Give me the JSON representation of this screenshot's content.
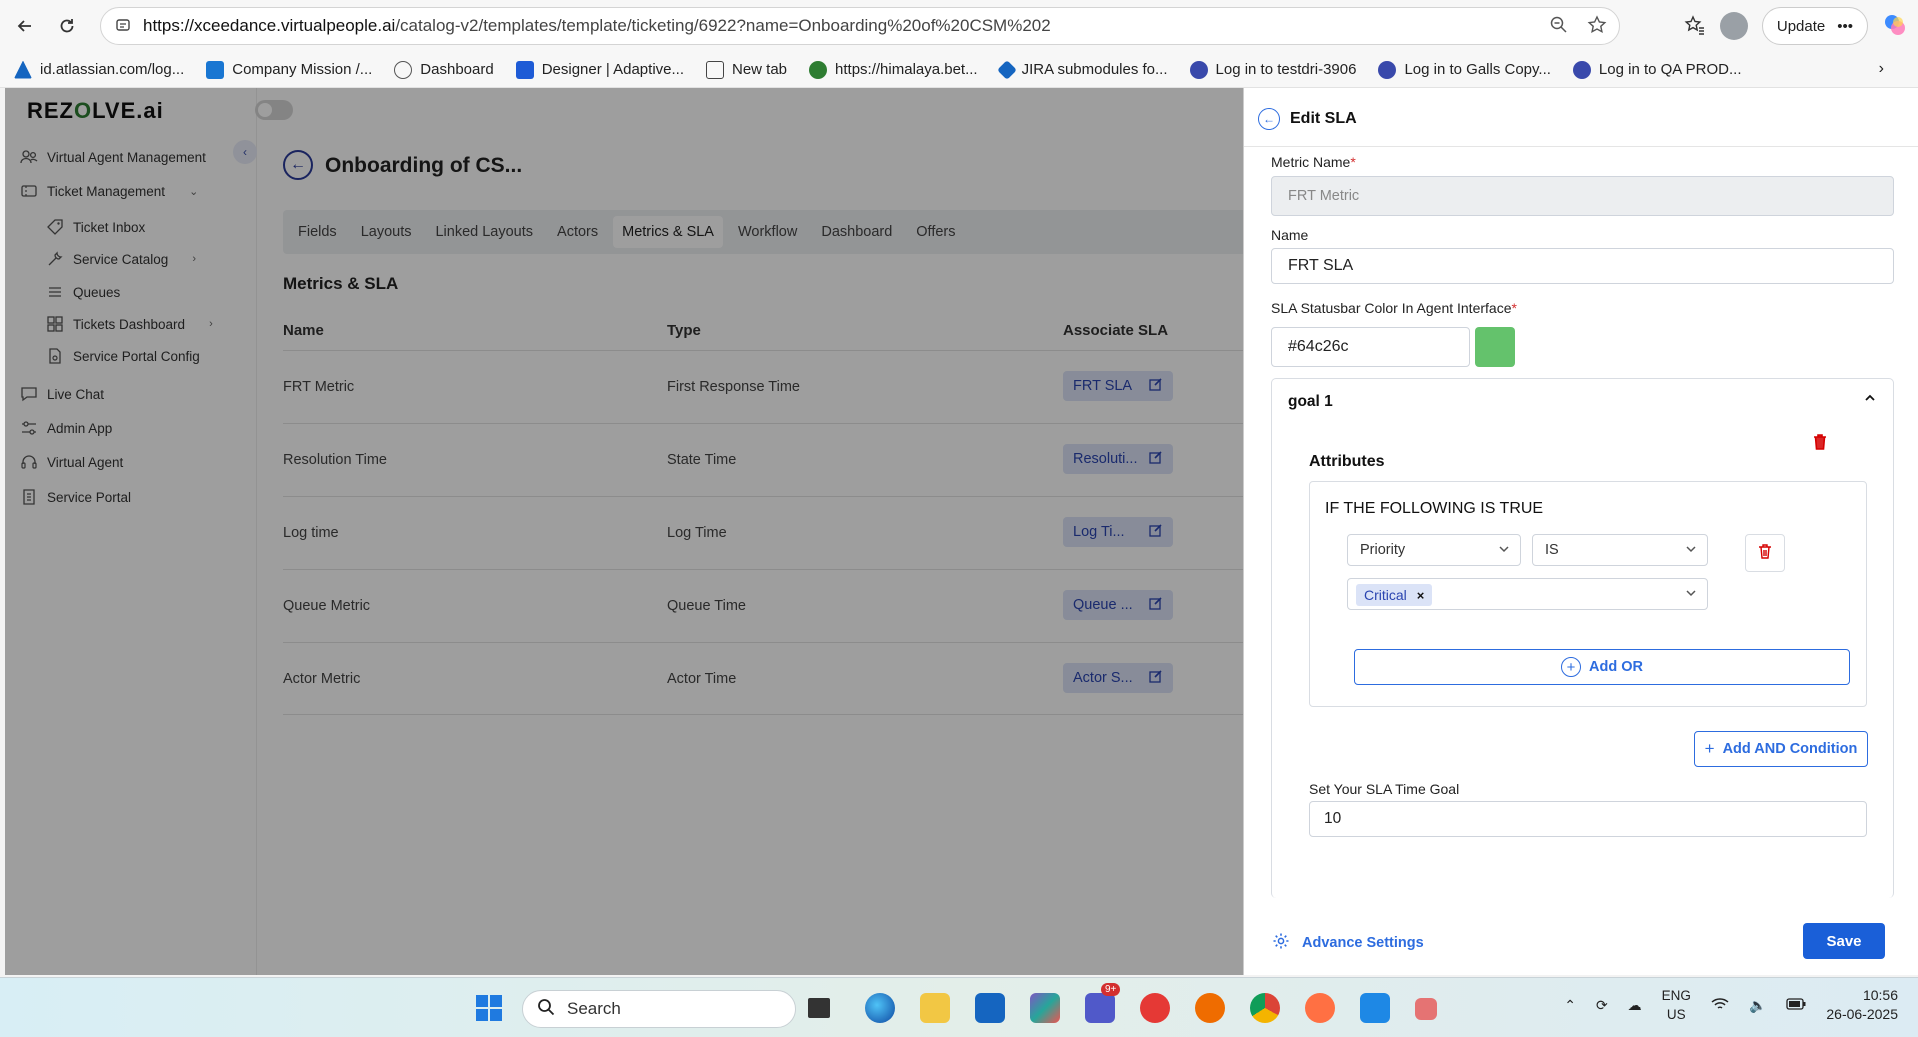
{
  "browser": {
    "url_host": "https://xceedance.virtualpeople.ai",
    "url_path": "/catalog-v2/templates/template/ticketing/6922?name=Onboarding%20of%20CSM%202",
    "update_label": "Update",
    "bookmarks": [
      {
        "label": "id.atlassian.com/log...",
        "color": "#1565c0"
      },
      {
        "label": "Company Mission /...",
        "color": "#1976d2"
      },
      {
        "label": "Dashboard",
        "color": "#555555"
      },
      {
        "label": "Designer | Adaptive...",
        "color": "#1e5bd6"
      },
      {
        "label": "New tab",
        "color": "#444444"
      },
      {
        "label": "https://himalaya.bet...",
        "color": "#2e7d32"
      },
      {
        "label": "JIRA submodules fo...",
        "color": "#1565c0"
      },
      {
        "label": "Log in to testdri-3906",
        "color": "#3949ab"
      },
      {
        "label": "Log in to Galls Copy...",
        "color": "#3949ab"
      },
      {
        "label": "Log in to QA PROD...",
        "color": "#3949ab"
      }
    ]
  },
  "app": {
    "logo_left": "REZ",
    "logo_o": "O",
    "logo_right": "LVE.ai",
    "sidebar": {
      "virtual_agent_mgmt": "Virtual Agent Management",
      "ticket_management": "Ticket Management",
      "ticket_inbox": "Ticket Inbox",
      "service_catalog": "Service Catalog",
      "queues": "Queues",
      "tickets_dashboard": "Tickets Dashboard",
      "service_portal_config": "Service Portal Config",
      "live_chat": "Live Chat",
      "admin_app": "Admin App",
      "virtual_agent": "Virtual Agent",
      "service_portal": "Service Portal"
    },
    "page_title": "Onboarding of CS...",
    "tabs": [
      "Fields",
      "Layouts",
      "Linked Layouts",
      "Actors",
      "Metrics & SLA",
      "Workflow",
      "Dashboard",
      "Offers"
    ],
    "section_title": "Metrics & SLA",
    "table": {
      "headers": {
        "name": "Name",
        "type": "Type",
        "associate": "Associate SLA"
      },
      "rows": [
        {
          "name": "FRT Metric",
          "type": "First Response Time",
          "sla": "FRT SLA"
        },
        {
          "name": "Resolution Time",
          "type": "State Time",
          "sla": "Resoluti..."
        },
        {
          "name": "Log time",
          "type": "Log Time",
          "sla": "Log Ti..."
        },
        {
          "name": "Queue Metric",
          "type": "Queue Time",
          "sla": "Queue ..."
        },
        {
          "name": "Actor Metric",
          "type": "Actor Time",
          "sla": "Actor S..."
        }
      ]
    }
  },
  "drawer": {
    "title": "Edit SLA",
    "metric_name_label": "Metric Name",
    "metric_name_value": "FRT Metric",
    "name_label": "Name",
    "name_value": "FRT SLA",
    "color_label": "SLA Statusbar Color In Agent Interface",
    "color_value": "#64c26c",
    "goal_title": "goal 1",
    "attributes_title": "Attributes",
    "condition_title": "IF THE FOLLOWING IS TRUE",
    "field_select": "Priority",
    "operator_select": "IS",
    "value_tag": "Critical",
    "add_or_label": "Add OR",
    "add_and_label": "Add AND Condition",
    "goal_time_label": "Set Your SLA Time Goal",
    "goal_time_value": "10",
    "advance_label": "Advance Settings",
    "save_label": "Save",
    "required_mark": "*"
  },
  "taskbar": {
    "search_label": "Search",
    "badge": "9+",
    "lang_line1": "ENG",
    "lang_line2": "US",
    "time": "10:56",
    "date": "26-06-2025"
  },
  "colors": {
    "accent": "#2d6cdf",
    "swatch": "#64c26c",
    "danger": "#d50000"
  }
}
